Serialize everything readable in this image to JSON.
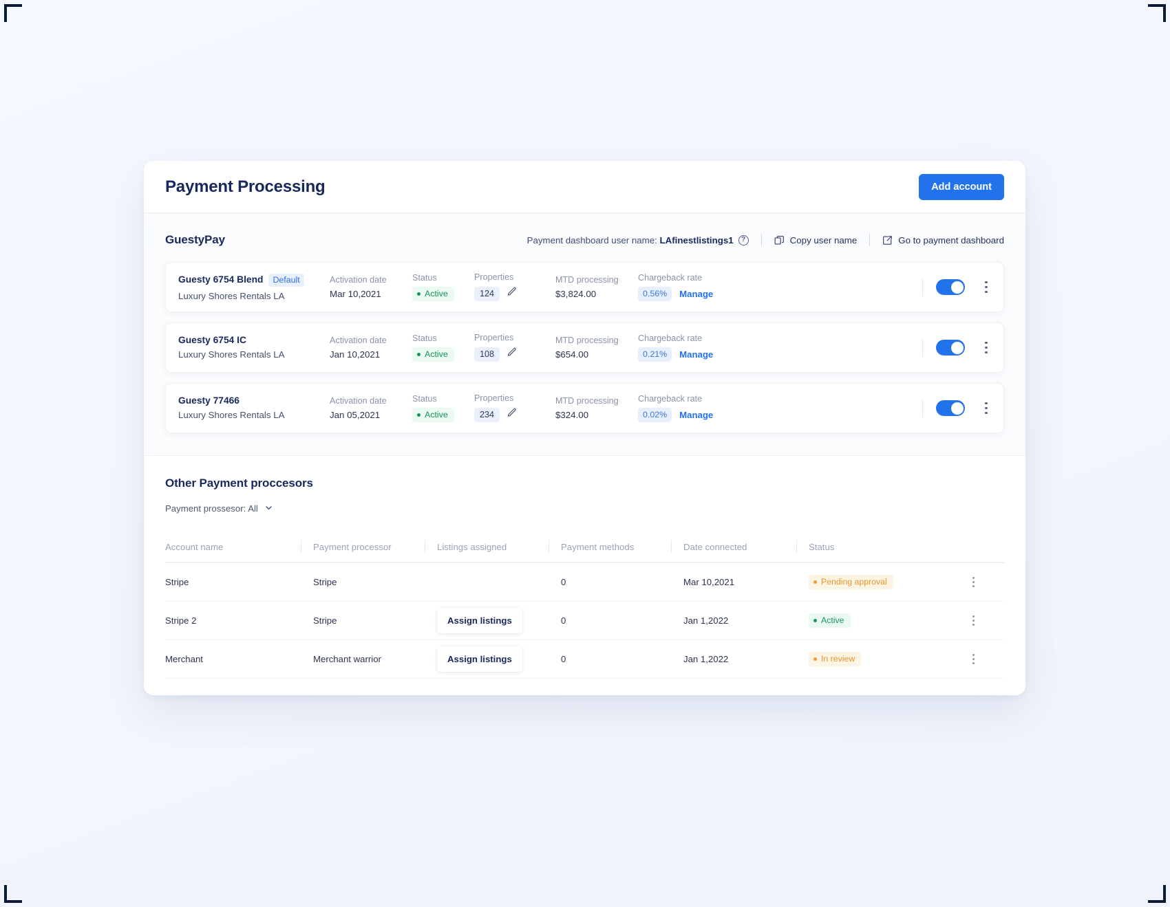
{
  "header": {
    "title": "Payment Processing",
    "add_account_label": "Add account"
  },
  "guestypay": {
    "section_title": "GuestyPay",
    "dashboard_user_label": "Payment dashboard user name:",
    "dashboard_user_value": "LAfinestlistings1",
    "help_icon": "question-circle-icon",
    "copy_label": "Copy user name",
    "copy_icon": "copy-icon",
    "dashboard_link_label": "Go to payment dashboard",
    "dashboard_link_icon": "external-link-icon",
    "col_labels": {
      "activation_date": "Activation date",
      "status": "Status",
      "properties": "Properties",
      "mtd": "MTD processing",
      "chargeback": "Chargeback rate"
    },
    "manage_label": "Manage",
    "accounts": [
      {
        "name": "Guesty 6754 Blend",
        "default_badge": "Default",
        "subtitle": "Luxury Shores Rentals LA",
        "activation_date": "Mar 10,2021",
        "status": "Active",
        "properties": "124",
        "mtd": "$3,824.00",
        "chargeback": "0.56%",
        "enabled": true
      },
      {
        "name": "Guesty 6754 IC",
        "default_badge": "",
        "subtitle": "Luxury Shores Rentals LA",
        "activation_date": "Jan 10,2021",
        "status": "Active",
        "properties": "108",
        "mtd": "$654.00",
        "chargeback": "0.21%",
        "enabled": true
      },
      {
        "name": "Guesty 77466",
        "default_badge": "",
        "subtitle": "Luxury Shores Rentals LA",
        "activation_date": "Jan 05,2021",
        "status": "Active",
        "properties": "234",
        "mtd": "$324.00",
        "chargeback": "0.02%",
        "enabled": true
      }
    ]
  },
  "other": {
    "section_title": "Other Payment proccesors",
    "filter_label": "Payment prossesor: All",
    "filter_icon": "chevron-down-icon",
    "columns": [
      "Account name",
      "Payment processor",
      "Listings assigned",
      "Payment methods",
      "Date connected",
      "Status"
    ],
    "assign_label": "Assign listings",
    "rows": [
      {
        "account_name": "Stripe",
        "processor": "Stripe",
        "has_assign": false,
        "payment_methods": "0",
        "date_connected": "Mar 10,2021",
        "status": "Pending approval",
        "status_kind": "pending"
      },
      {
        "account_name": "Stripe 2",
        "processor": "Stripe",
        "has_assign": true,
        "payment_methods": "0",
        "date_connected": "Jan 1,2022",
        "status": "Active",
        "status_kind": "active"
      },
      {
        "account_name": "Merchant",
        "processor": "Merchant warrior",
        "has_assign": true,
        "payment_methods": "0",
        "date_connected": "Jan 1,2022",
        "status": "In review",
        "status_kind": "review"
      }
    ]
  },
  "colors": {
    "accent": "#2272eb",
    "title": "#17295c",
    "success": "#18935a",
    "warning": "#e5962a"
  }
}
